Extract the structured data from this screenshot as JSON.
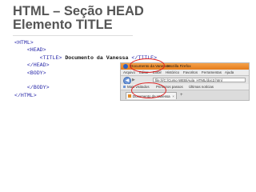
{
  "slide": {
    "title_line1": "HTML – Seção HEAD",
    "title_line2": "Elemento TITLE"
  },
  "code_lines": [
    {
      "indent": "",
      "tag": "<HTML>"
    },
    {
      "indent": "    ",
      "tag": "<HEAD>"
    },
    {
      "indent": "        ",
      "tag_open": "<TITLE>",
      "text": " Documento da Vanessa ",
      "tag_close": "</TITLE>"
    },
    {
      "indent": "    ",
      "tag": "</HEAD>"
    },
    {
      "indent": "    ",
      "tag": "<BODY>"
    },
    {
      "indent": "",
      "tag": ""
    },
    {
      "indent": "    ",
      "tag": "</BODY>"
    },
    {
      "indent": "",
      "tag": "</HTML>"
    }
  ],
  "browser": {
    "window_title": "Documento da Vanessa",
    "app_name": "Mozilla Firefox",
    "menu": [
      "Arquivo",
      "Editar",
      "Exibir",
      "Histórico",
      "Favoritos",
      "Ferramentas",
      "Ajuda"
    ],
    "url": "file:///C:/Curso WEB/Aula_HTML/doc2.html",
    "bookmarks": [
      "Mais visitados",
      "Primeiros passos",
      "Últimas notícias"
    ],
    "tab_label": "Documento da Vanessa",
    "new_tab": "+",
    "close_tab": "×",
    "back": "◀",
    "forward": "▶"
  },
  "colors": {
    "title": "#555555",
    "tag": "#2626a8",
    "highlight_circle": "#e02020"
  }
}
